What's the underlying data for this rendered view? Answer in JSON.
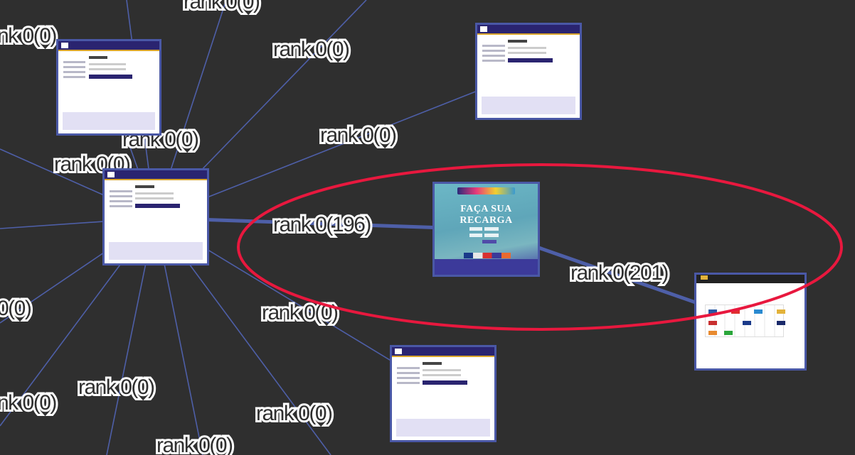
{
  "graph": {
    "edge_labels": {
      "l1": "rank 0(0)",
      "l2": "rank 0(0)",
      "l3": "rank 0(0)",
      "l4": "rank 0(0)",
      "l5": "rank 0(0)",
      "l6": "rank 0(196)",
      "l7": "rank 0(201)",
      "l8": "rank 0(0)",
      "l9": "0(0)",
      "l10": "rank 0(0)",
      "l11": "nk 0(0)",
      "l12": "rank 0(0)",
      "l13": "rank 0(0)",
      "l14": "nk 0(0)"
    },
    "highlight_color": "#e8183e",
    "edge_color": "#4e5fa8",
    "background": "#2f2f2f"
  },
  "nodes": {
    "recharge_page": {
      "title": "FAÇA SUA RECARGA"
    }
  }
}
